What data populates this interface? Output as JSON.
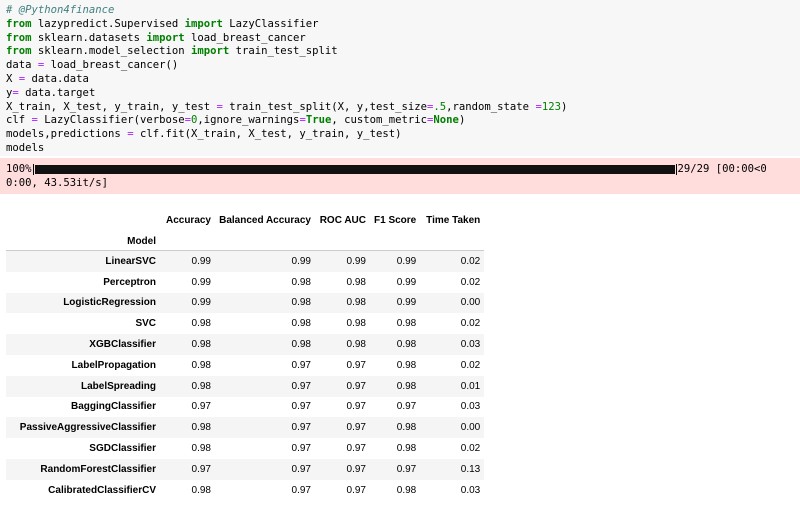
{
  "code_cell": {
    "lines": [
      [
        {
          "t": "# @Python4finance",
          "c": "comment"
        }
      ],
      [
        {
          "t": "from",
          "c": "kw"
        },
        {
          "t": " lazypredict.Supervised "
        },
        {
          "t": "import",
          "c": "kw"
        },
        {
          "t": " LazyClassifier"
        }
      ],
      [
        {
          "t": "from",
          "c": "kw"
        },
        {
          "t": " sklearn.datasets "
        },
        {
          "t": "import",
          "c": "kw"
        },
        {
          "t": " load_breast_cancer"
        }
      ],
      [
        {
          "t": "from",
          "c": "kw"
        },
        {
          "t": " sklearn.model_selection "
        },
        {
          "t": "import",
          "c": "kw"
        },
        {
          "t": " train_test_split"
        }
      ],
      [
        {
          "t": "data "
        },
        {
          "t": "=",
          "c": "op"
        },
        {
          "t": " load_breast_cancer()"
        }
      ],
      [
        {
          "t": "X "
        },
        {
          "t": "=",
          "c": "op"
        },
        {
          "t": " data.data"
        }
      ],
      [
        {
          "t": "y"
        },
        {
          "t": "=",
          "c": "op"
        },
        {
          "t": " data.target"
        }
      ],
      [
        {
          "t": "X_train, X_test, y_train, y_test "
        },
        {
          "t": "=",
          "c": "op"
        },
        {
          "t": " train_test_split(X, y,test_size"
        },
        {
          "t": "=",
          "c": "op"
        },
        {
          "t": ".5",
          "c": "num"
        },
        {
          "t": ",random_state "
        },
        {
          "t": "=",
          "c": "op"
        },
        {
          "t": "123",
          "c": "num"
        },
        {
          "t": ")"
        }
      ],
      [
        {
          "t": "clf "
        },
        {
          "t": "=",
          "c": "op"
        },
        {
          "t": " LazyClassifier(verbose"
        },
        {
          "t": "=",
          "c": "op"
        },
        {
          "t": "0",
          "c": "num"
        },
        {
          "t": ",ignore_warnings"
        },
        {
          "t": "=",
          "c": "op"
        },
        {
          "t": "True",
          "c": "kw"
        },
        {
          "t": ", custom_metric"
        },
        {
          "t": "=",
          "c": "op"
        },
        {
          "t": "None",
          "c": "kw"
        },
        {
          "t": ")"
        }
      ],
      [
        {
          "t": "models,predictions "
        },
        {
          "t": "=",
          "c": "op"
        },
        {
          "t": " clf.fit(X_train, X_test, y_train, y_test)"
        }
      ],
      [
        {
          "t": "models"
        }
      ]
    ]
  },
  "progress": {
    "percent_label": "100%",
    "fraction": 1.0,
    "suffix": "29/29 [00:00<0",
    "line2": "0:00, 43.53it/s]"
  },
  "table": {
    "columns": [
      "Accuracy",
      "Balanced Accuracy",
      "ROC AUC",
      "F1 Score",
      "Time Taken"
    ],
    "index_name": "Model",
    "rows": [
      {
        "model": "LinearSVC",
        "values": [
          "0.99",
          "0.99",
          "0.99",
          "0.99",
          "0.02"
        ]
      },
      {
        "model": "Perceptron",
        "values": [
          "0.99",
          "0.98",
          "0.98",
          "0.99",
          "0.02"
        ]
      },
      {
        "model": "LogisticRegression",
        "values": [
          "0.99",
          "0.98",
          "0.98",
          "0.99",
          "0.00"
        ]
      },
      {
        "model": "SVC",
        "values": [
          "0.98",
          "0.98",
          "0.98",
          "0.98",
          "0.02"
        ]
      },
      {
        "model": "XGBClassifier",
        "values": [
          "0.98",
          "0.98",
          "0.98",
          "0.98",
          "0.03"
        ]
      },
      {
        "model": "LabelPropagation",
        "values": [
          "0.98",
          "0.97",
          "0.97",
          "0.98",
          "0.02"
        ]
      },
      {
        "model": "LabelSpreading",
        "values": [
          "0.98",
          "0.97",
          "0.97",
          "0.98",
          "0.01"
        ]
      },
      {
        "model": "BaggingClassifier",
        "values": [
          "0.97",
          "0.97",
          "0.97",
          "0.97",
          "0.03"
        ]
      },
      {
        "model": "PassiveAggressiveClassifier",
        "values": [
          "0.98",
          "0.97",
          "0.97",
          "0.98",
          "0.00"
        ]
      },
      {
        "model": "SGDClassifier",
        "values": [
          "0.98",
          "0.97",
          "0.97",
          "0.98",
          "0.02"
        ]
      },
      {
        "model": "RandomForestClassifier",
        "values": [
          "0.97",
          "0.97",
          "0.97",
          "0.97",
          "0.13"
        ]
      },
      {
        "model": "CalibratedClassifierCV",
        "values": [
          "0.98",
          "0.97",
          "0.97",
          "0.98",
          "0.03"
        ]
      }
    ]
  }
}
